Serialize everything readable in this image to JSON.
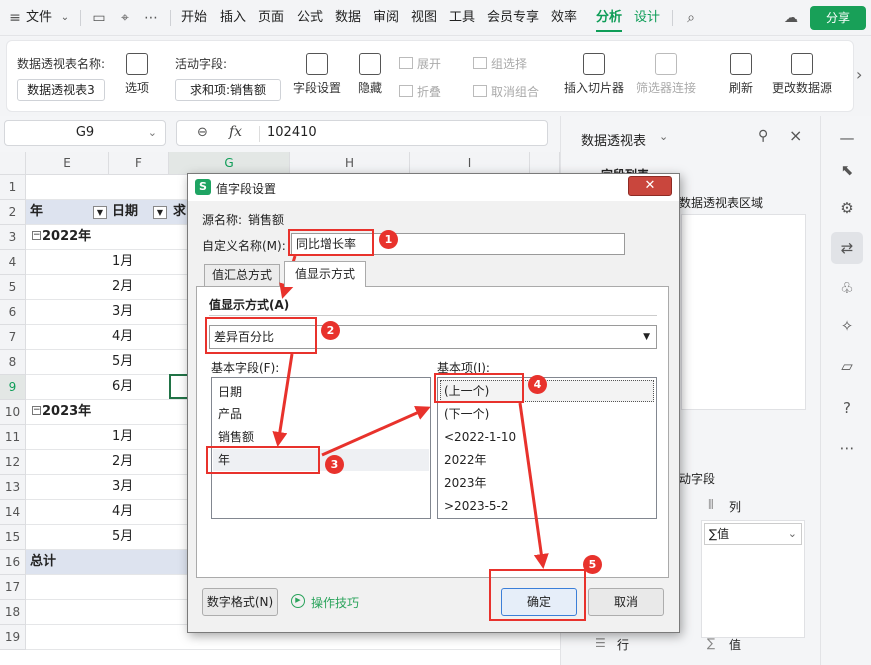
{
  "menubar": {
    "file": "文件",
    "items": [
      "开始",
      "插入",
      "页面",
      "公式",
      "数据",
      "审阅",
      "视图",
      "工具",
      "会员专享",
      "效率",
      "分析",
      "设计"
    ],
    "share": "分享"
  },
  "ribbon": {
    "pt_name_label": "数据透视表名称:",
    "pt_name_value": "数据透视表3",
    "options": "选项",
    "active_field_label": "活动字段:",
    "active_field_value": "求和项:销售额",
    "field_settings": "字段设置",
    "hide": "隐藏",
    "expand": "展开",
    "collapse": "折叠",
    "group_selection": "组选择",
    "ungroup": "取消组合",
    "insert_slicer": "插入切片器",
    "filter_connections": "筛选器连接",
    "refresh": "刷新",
    "change_source": "更改数据源"
  },
  "formula_bar": {
    "cell_ref": "G9",
    "fx": "fx",
    "value": "102410"
  },
  "sheet": {
    "columns": [
      "E",
      "F",
      "G",
      "H",
      "I"
    ],
    "rows": [
      "1",
      "2",
      "3",
      "4",
      "5",
      "6",
      "7",
      "8",
      "9",
      "10",
      "11",
      "12",
      "13",
      "14",
      "15",
      "16",
      "17",
      "18",
      "19"
    ],
    "header_year": "年",
    "header_date": "日期",
    "header_sum": "求",
    "y2022": "2022年",
    "y2023": "2023年",
    "total": "总计",
    "months_2022": [
      "1月",
      "2月",
      "3月",
      "4月",
      "5月",
      "6月"
    ],
    "months_2023": [
      "1月",
      "2月",
      "3月",
      "4月",
      "5月"
    ]
  },
  "right_panel": {
    "title": "数据透视表",
    "field_list": "字段列表",
    "area_text": "数据透视表区域",
    "drag_text": "动字段",
    "columns_label": "列",
    "values_chip": "∑值",
    "rows_label": "行",
    "values_label": "值"
  },
  "dialog": {
    "title": "值字段设置",
    "source_label": "源名称:",
    "source_value": "销售额",
    "custom_name_label": "自定义名称(M):",
    "custom_name_value": "同比增长率",
    "tab_summary": "值汇总方式",
    "tab_show": "值显示方式",
    "show_as_label": "值显示方式(A)",
    "show_as_value": "差异百分比",
    "base_field_label": "基本字段(F):",
    "base_fields": [
      "日期",
      "产品",
      "销售额",
      "年"
    ],
    "base_item_label": "基本项(I):",
    "base_items": [
      "(上一个)",
      "(下一个)",
      "<2022-1-10",
      "2022年",
      "2023年",
      ">2023-5-2"
    ],
    "number_format": "数字格式(N)",
    "tips": "操作技巧",
    "ok": "确定",
    "cancel": "取消"
  },
  "annotations": [
    "1",
    "2",
    "3",
    "4",
    "5"
  ],
  "colors": {
    "accent": "#0f9d58",
    "annotation": "#e8322c"
  }
}
